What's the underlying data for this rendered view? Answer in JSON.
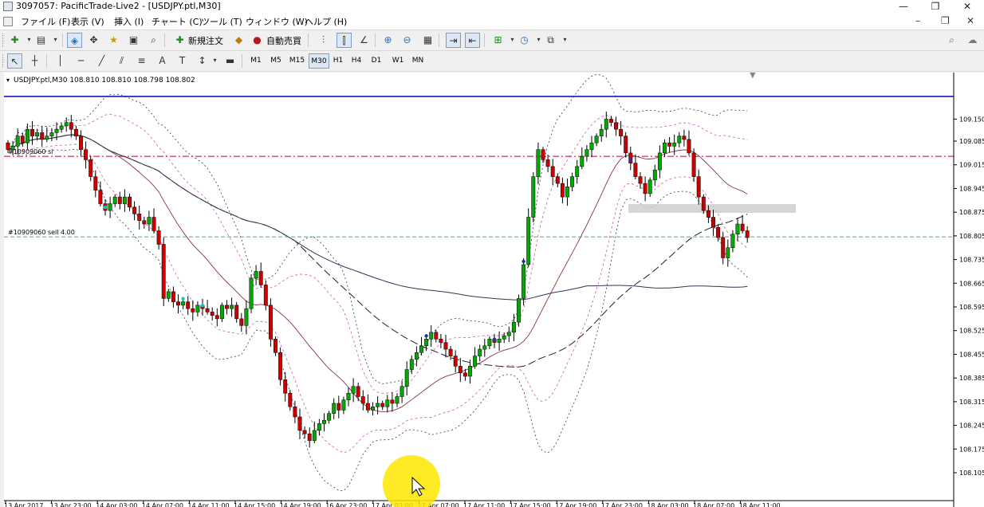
{
  "window": {
    "title": "3097057: PacificTrade-Live2 - [USDJPY.ptl,M30]",
    "minimize": "—",
    "restore": "❐",
    "close": "✕"
  },
  "menu": {
    "items": [
      "ファイル (F)",
      "表示 (V)",
      "挿入 (I)",
      "チャート (C)",
      "ツール (T)",
      "ウィンドウ (W)",
      "ヘルプ (H)"
    ],
    "mdi_minimize": "–",
    "mdi_restore": "❐",
    "mdi_close": "✕"
  },
  "toolbar": {
    "new_order_label": "新規注文",
    "auto_trade_label": "自動売買"
  },
  "timeframes": [
    "M1",
    "M5",
    "M15",
    "M30",
    "H1",
    "H4",
    "D1",
    "W1",
    "MN"
  ],
  "active_timeframe": "M30",
  "chart_data": {
    "type": "candlestick",
    "header": "USDJPY.ptl,M30  108.810 108.810 108.798 108.802",
    "price_axis": {
      "min": 108.105,
      "max": 109.217,
      "ticks": [
        109.15,
        109.085,
        109.015,
        108.945,
        108.875,
        108.805,
        108.735,
        108.665,
        108.595,
        108.525,
        108.455,
        108.385,
        108.315,
        108.245,
        108.175,
        108.105
      ]
    },
    "time_axis": [
      "13 Apr 2017",
      "13 Apr 23:00",
      "14 Apr 03:00",
      "14 Apr 07:00",
      "14 Apr 11:00",
      "14 Apr 15:00",
      "14 Apr 19:00",
      "16 Apr 23:00",
      "17 Apr 03:00",
      "17 Apr 07:00",
      "17 Apr 11:00",
      "17 Apr 15:00",
      "17 Apr 19:00",
      "17 Apr 23:00",
      "18 Apr 03:00",
      "18 Apr 07:00",
      "18 Apr 11:00"
    ],
    "horizontal_lines": [
      {
        "label": "",
        "price": 109.217,
        "price_tag": "109.217",
        "color": "#0000cc",
        "style": "solid"
      },
      {
        "label": "#10909060 sl",
        "price": 109.04,
        "color": "#cc0033",
        "style": "dashdot"
      },
      {
        "label": "#10909060 sell 4.00",
        "price": 108.802,
        "price_tag": "108.802",
        "color": "#44aa88",
        "style": "dashed"
      }
    ],
    "current_price": 108.802,
    "closes": [
      109.06,
      109.07,
      109.1,
      109.08,
      109.12,
      109.1,
      109.11,
      109.09,
      109.1,
      109.11,
      109.12,
      109.13,
      109.14,
      109.12,
      109.1,
      109.06,
      109.03,
      108.98,
      108.94,
      108.9,
      108.88,
      108.9,
      108.92,
      108.9,
      108.92,
      108.89,
      108.87,
      108.85,
      108.84,
      108.86,
      108.82,
      108.78,
      108.62,
      108.64,
      108.61,
      108.6,
      108.61,
      108.59,
      108.58,
      108.6,
      108.59,
      108.58,
      108.57,
      108.56,
      108.6,
      108.59,
      108.6,
      108.56,
      108.54,
      108.59,
      108.68,
      108.7,
      108.66,
      108.6,
      108.5,
      108.46,
      108.38,
      108.34,
      108.3,
      108.27,
      108.23,
      108.22,
      108.2,
      108.23,
      108.25,
      108.26,
      108.28,
      108.31,
      108.29,
      108.32,
      108.34,
      108.36,
      108.33,
      108.31,
      108.29,
      108.3,
      108.31,
      108.3,
      108.32,
      108.31,
      108.33,
      108.36,
      108.41,
      108.44,
      108.46,
      108.48,
      108.5,
      108.52,
      108.5,
      108.49,
      108.47,
      108.45,
      108.42,
      108.4,
      108.39,
      108.42,
      108.45,
      108.47,
      108.48,
      108.5,
      108.49,
      108.5,
      108.51,
      108.52,
      108.55,
      108.62,
      108.72,
      108.86,
      108.98,
      109.06,
      109.03,
      109.01,
      108.98,
      108.96,
      108.92,
      108.95,
      108.98,
      109.01,
      109.04,
      109.06,
      109.08,
      109.1,
      109.12,
      109.15,
      109.14,
      109.12,
      109.1,
      109.05,
      109.02,
      108.98,
      108.96,
      108.93,
      108.97,
      109.0,
      109.05,
      109.08,
      109.07,
      109.08,
      109.1,
      109.09,
      109.05,
      108.98,
      108.92,
      108.88,
      108.86,
      108.83,
      108.8,
      108.74,
      108.77,
      108.81,
      108.84,
      108.82,
      108.8
    ]
  },
  "colors": {
    "up": "#00aa00",
    "down": "#cc0000",
    "outline": "#000000"
  }
}
